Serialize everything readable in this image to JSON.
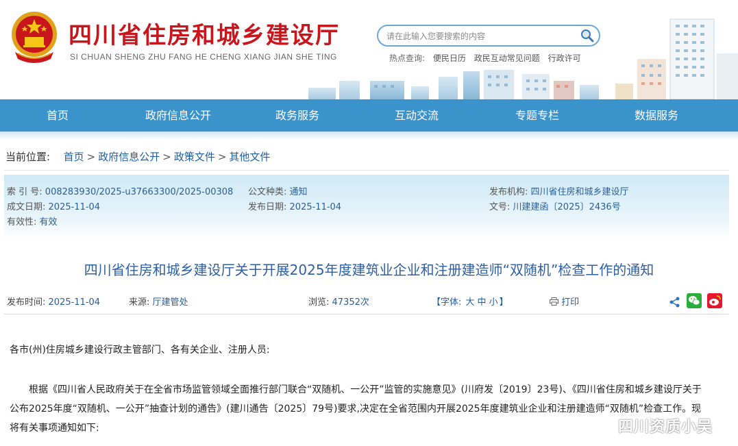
{
  "header": {
    "title_cn": "四川省住房和城乡建设厅",
    "title_en": "SI CHUAN SHENG ZHU FANG HE CHENG XIANG JIAN SHE TING",
    "emblem_icon": "national-emblem-icon",
    "search": {
      "placeholder": "请在此输入您要搜索的内容"
    },
    "hot": {
      "label": "热点查询:",
      "links": [
        "便民日历",
        "政民互动常见问题",
        "行政许可"
      ]
    }
  },
  "nav": {
    "items": [
      "首页",
      "政府信息公开",
      "政务服务",
      "互动交流",
      "专题专栏",
      "数据服务"
    ]
  },
  "breadcrumb": {
    "label": "当前位置:",
    "items": [
      "首页",
      "政府信息公开",
      "政策文件",
      "其他文件"
    ],
    "separator": ">"
  },
  "meta": {
    "index_label": "索 引 号:",
    "index_value": "008283930/2025-u37663300/2025-00308",
    "category_label": "公文种类:",
    "category_value": "通知",
    "org_label": "发布机构:",
    "org_value": "四川省住房和城乡建设厅",
    "made_label": "成文日期:",
    "made_value": "2025-11-04",
    "pub_label": "发布日期:",
    "pub_value": "2025-11-04",
    "doc_label": "文号:",
    "doc_value": "川建建函〔2025〕2436号",
    "valid_label": "有效性:",
    "valid_value": "有效"
  },
  "article": {
    "title": "四川省住房和城乡建设厅关于开展2025年度建筑业企业和注册建造师“双随机”检查工作的通知",
    "pub_time_label": "发布时间:",
    "pub_time": "2025-11-04",
    "source_label": "来源:",
    "source": "厅建管处",
    "views_label": "浏览:",
    "views": "47352次",
    "font_label_open": "【字体:",
    "font_sizes": [
      "大",
      "中",
      "小"
    ],
    "font_label_close": "】",
    "print_label": "打印",
    "salutation": "各市(州)住房城乡建设行政主管部门、各有关企业、注册人员:",
    "para1_line1": "根据《四川省人民政府关于在全省市场监管领域全面推行部门联合“双随机、一公开”监管的实施意见》(川府发〔2019〕23号)、《四川省住房和城乡建设厅关于",
    "para1_line2": "公布2025年度“双随机、一公开”抽查计划的通告》(建川通告〔2025〕79号)要求,决定在全省范围内开展2025年度建筑业企业和注册建造师“双随机”检查工作。现",
    "para1_line3": "将有关事项通知如下:"
  },
  "watermark": "四川资质小吴",
  "colors": {
    "nav_bg": "#3b93cc",
    "title_red": "#c8161d",
    "link_blue": "#1f5ea3",
    "article_title": "#2d5fa6",
    "wechat_green": "#2aae3b",
    "weibo_red": "#e6162d"
  }
}
